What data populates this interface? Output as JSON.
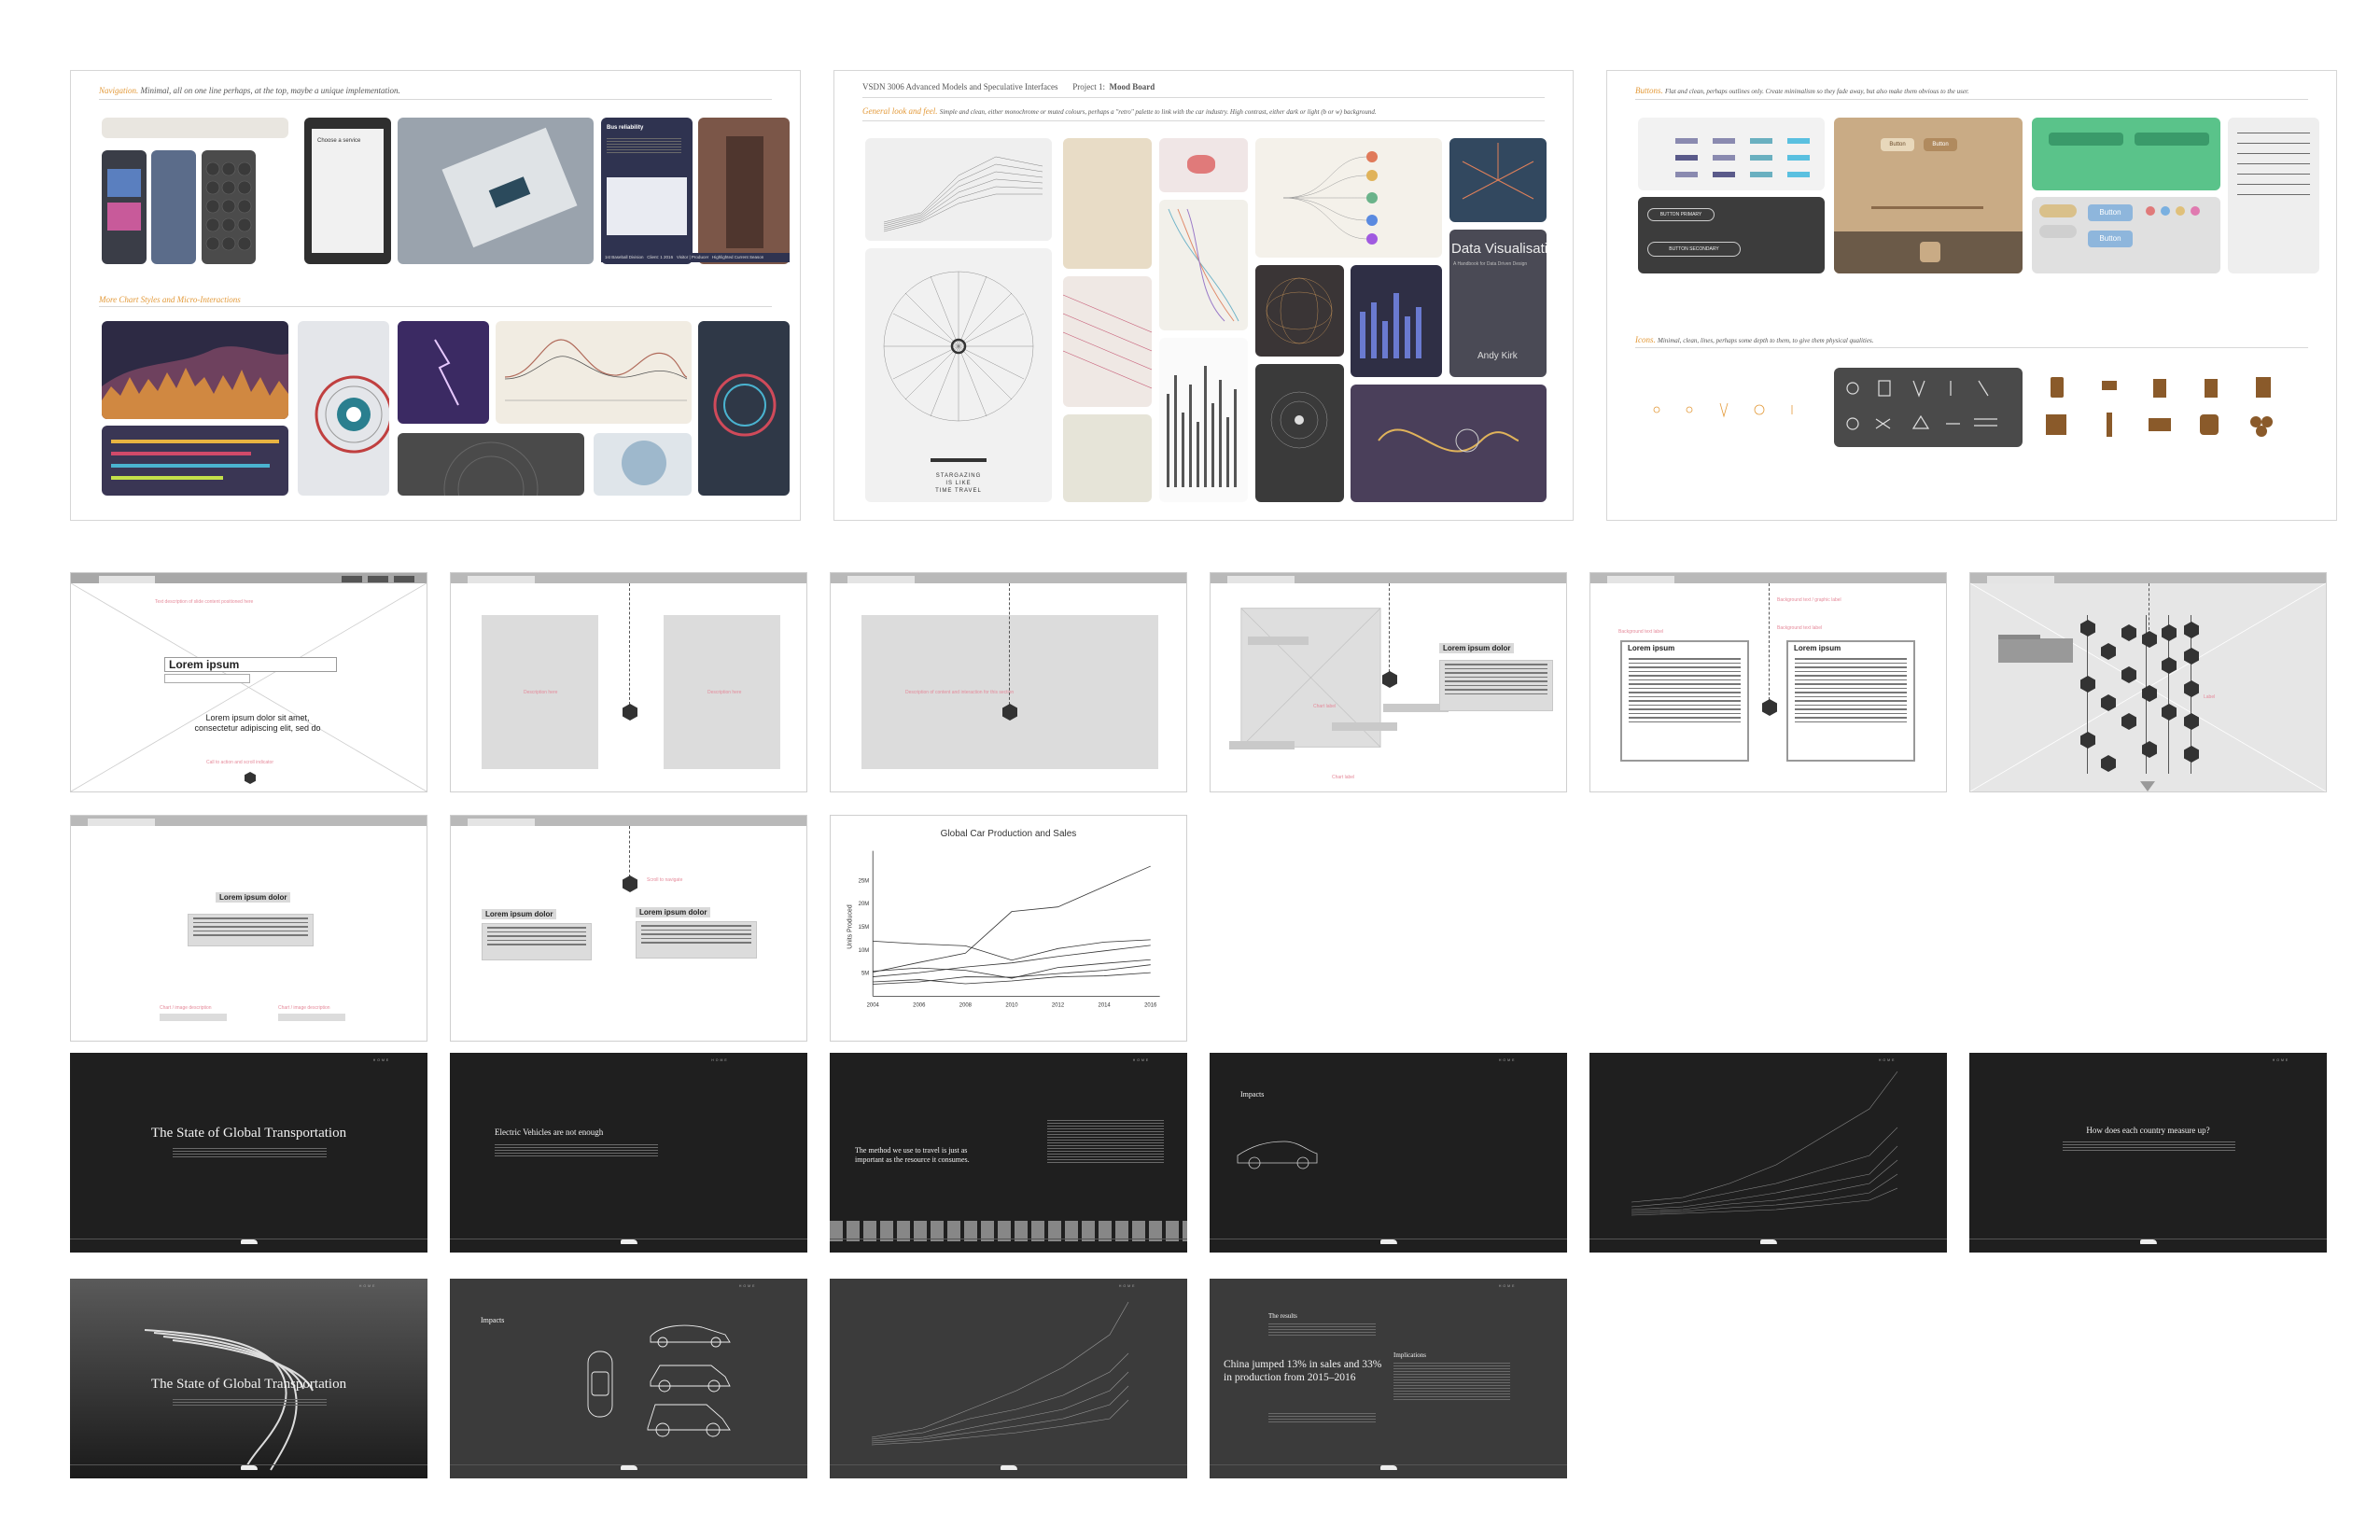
{
  "boards": {
    "nav": {
      "heading": "Navigation.",
      "note": "Minimal, all on one line perhaps, at the top, maybe a unique implementation.",
      "heading2": "More Chart Styles and Micro-Interactions",
      "caption": [
        "1st Baseball Division",
        "Client: 1 2016",
        "Visitor | Producer",
        "Highlighted Current Season"
      ],
      "phone_text": "Choose a service",
      "card_title": "Bus reliability"
    },
    "mood": {
      "course": "VSDN 3006 Advanced Models and Speculative Interfaces",
      "project_label": "Project 1:",
      "project_title": "Mood Board",
      "subheading": "General look and feel.",
      "subnote": "Simple and clean, either monochrome or muted colours, perhaps a \"retro\" palette to link with the car industry. High contrast, either dark or light (b or w) background.",
      "poster_text": [
        "STARGAZING",
        "IS LIKE",
        "TIME TRAVEL"
      ],
      "dataviz": "Data Visualisation",
      "dataviz_sub": "A Handbook for Data Driven Design",
      "author": "Andy Kirk"
    },
    "ui": {
      "heading": "Buttons.",
      "note": "Flat and clean, perhaps outlines only. Create minimalism so they fade away, but also make them obvious to the user.",
      "btn_primary": "BUTTON PRIMARY",
      "btn_secondary": "BUTTON SECONDARY",
      "button_label": "Button",
      "icons_heading": "Icons.",
      "icons_note": "Minimal, clean, lines, perhaps some depth to them, to give them physical qualities."
    }
  },
  "wireframes": {
    "w1": {
      "title": "Lorem ipsum",
      "subtitle": "Lorem ipsum dolor sit amet, consectetur adipiscing elit, sed do"
    },
    "w4": {
      "label": "Lorem ipsum dolor"
    },
    "w5": {
      "label_left": "Lorem ipsum",
      "label_right": "Lorem ipsum"
    },
    "w7": {
      "label": "Lorem ipsum dolor"
    },
    "w8": {
      "label_left": "Lorem ipsum dolor",
      "label_right": "Lorem ipsum dolor"
    }
  },
  "chart_data": {
    "type": "line",
    "title": "Global Car Production and Sales",
    "ylabel": "Units Produced",
    "x": [
      2004,
      2006,
      2008,
      2010,
      2012,
      2014,
      2016
    ],
    "yticks": [
      "5M",
      "10M",
      "15M",
      "20M",
      "25M"
    ],
    "ylim": [
      0,
      30
    ],
    "series": [
      {
        "values": [
          5.2,
          7.3,
          9.3,
          18.3,
          19.3,
          23.7,
          28.1
        ]
      },
      {
        "values": [
          11.9,
          11.3,
          10.9,
          7.8,
          10.3,
          11.7,
          12.2
        ]
      },
      {
        "values": [
          4.2,
          5.1,
          6.3,
          7.2,
          8.6,
          9.8,
          11.0
        ]
      },
      {
        "values": [
          5.4,
          6.1,
          5.6,
          3.9,
          6.2,
          7.1,
          7.9
        ]
      },
      {
        "values": [
          2.6,
          3.1,
          4.2,
          4.1,
          4.9,
          5.6,
          6.8
        ]
      },
      {
        "values": [
          3.1,
          3.6,
          2.7,
          3.3,
          4.2,
          4.4,
          5.1
        ]
      }
    ]
  },
  "slides": {
    "s1": {
      "title": "The State of Global Transportation"
    },
    "s2": {
      "title": "Electric Vehicles are not enough"
    },
    "s3": {
      "title": "The method we use to travel is just as important as the resource it consumes."
    },
    "s4": {
      "title": "Impacts"
    },
    "s6": {
      "title": "How does each country measure up?"
    },
    "s7": {
      "title": "The State of Global Transportation"
    },
    "s8": {
      "title": "Impacts"
    },
    "s10": {
      "kicker": "The results",
      "title": "China jumped 13% in sales and 33% in production from 2015–2016",
      "side_title": "Implications"
    }
  }
}
